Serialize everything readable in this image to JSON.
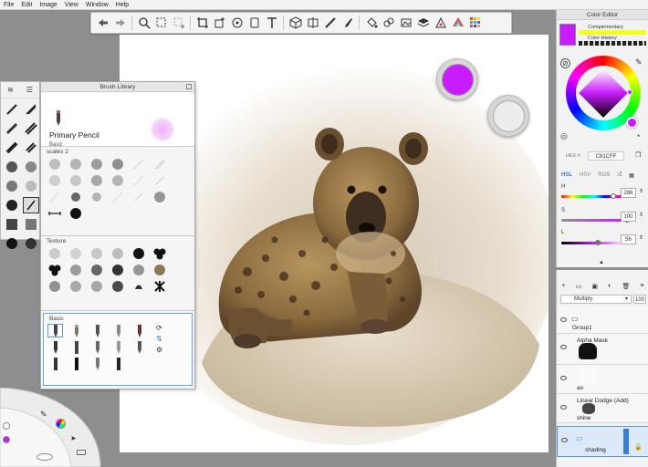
{
  "menu": [
    "File",
    "Edit",
    "Image",
    "View",
    "Window",
    "Help"
  ],
  "toolbar": {
    "icons": [
      "undo-icon",
      "redo-icon",
      "zoom-icon",
      "select-icon",
      "lasso-icon",
      "crop-icon",
      "transform-icon",
      "stamp-icon",
      "text-icon",
      "perspective-icon",
      "ruler-icon",
      "brush-icon",
      "fill-icon",
      "copic-icon",
      "layers-icon",
      "palette-icon",
      "color-wheel-icon",
      "grid-icon"
    ]
  },
  "brush_library": {
    "title": "Brush Library",
    "selected_brush": "Primary Pencil",
    "selected_set": "Basic",
    "sections": [
      "scales 2",
      "Texture",
      "Basic"
    ]
  },
  "color_editor": {
    "title": "Color Editor",
    "complementary_label": "Complementary",
    "history_label": "Color History",
    "hex_label": "HEX #",
    "hex_value": "C81CFF",
    "modes": [
      "HSL",
      "HSV",
      "RGB"
    ],
    "h_label": "H",
    "h_value": "286",
    "s_label": "S",
    "s_value": "100",
    "l_label": "L",
    "l_value": "56",
    "h_fraction": 0.79,
    "s_fraction": 1.0,
    "l_fraction": 0.56,
    "current_color": "#C81CFF"
  },
  "layers": {
    "blend_mode": "Multiply",
    "opacity": "100",
    "items": [
      {
        "name": "Group1",
        "type": "group"
      },
      {
        "name": "Alpha Mask",
        "type": "layer"
      },
      {
        "name": "ao",
        "type": "layer"
      },
      {
        "name": "Linear Dodge (Add)",
        "type": "layer"
      },
      {
        "name": "shine",
        "type": "layer"
      },
      {
        "name": "shading",
        "type": "group",
        "selected": true
      }
    ]
  }
}
